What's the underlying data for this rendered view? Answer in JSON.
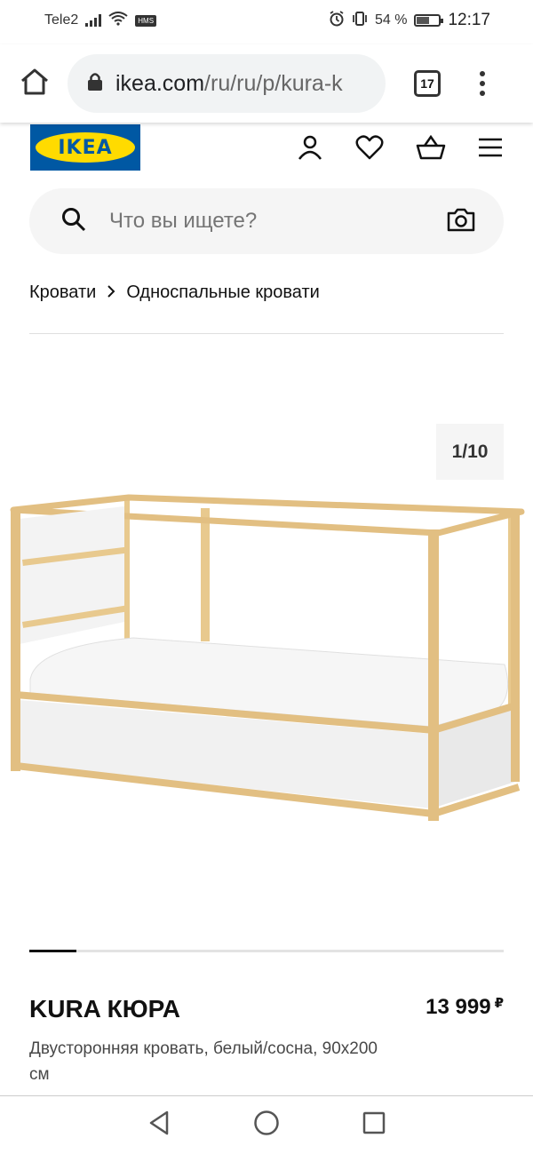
{
  "status_bar": {
    "carrier": "Tele2",
    "hms_badge": "HMS",
    "battery_percent": "54 %",
    "battery_level": 0.54,
    "time": "12:17"
  },
  "browser": {
    "url_host": "ikea.com",
    "url_path": "/ru/ru/p/kura-k",
    "tab_count": "17"
  },
  "header": {
    "logo_text": "IKEA",
    "colors": {
      "logo_blue": "#0058a3",
      "logo_yellow": "#ffdb00"
    }
  },
  "search": {
    "placeholder": "Что вы ищете?"
  },
  "breadcrumb": {
    "items": [
      "Кровати",
      "Односпальные кровати"
    ]
  },
  "gallery": {
    "counter": "1/10",
    "progress_fraction": 0.1
  },
  "product": {
    "name": "KURA КЮРА",
    "price": "13 999",
    "currency": "₽",
    "description": "Двусторонняя кровать, белый/сосна, 90x200 см"
  }
}
